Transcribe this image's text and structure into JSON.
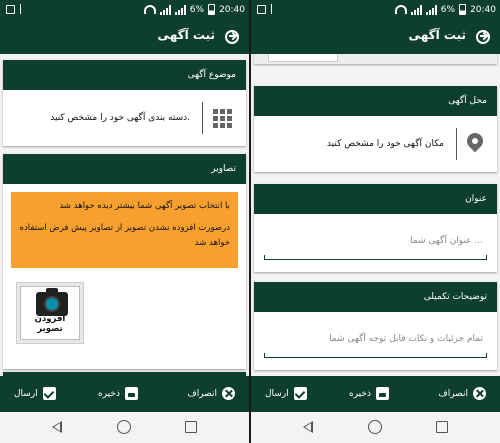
{
  "status": {
    "battery": "6%",
    "time": "20:40"
  },
  "appbar": {
    "title": "ثبت آگهی"
  },
  "left": {
    "category": {
      "header": "موضوع آگهی",
      "prompt": "دسته بندی آگهی خود را مشخص کنید."
    },
    "images": {
      "header": "تصاویر",
      "notice_line1": "با انتخاب تصویر آگهی شما بیشتر دیده خواهد شد",
      "notice_line2": "درصورت افزوده نشدن تصویر از تصاویر پیش فرض استفاده خواهد شد",
      "add_label": "افزودن تصویر"
    }
  },
  "right": {
    "location": {
      "header": "محل آگهی",
      "prompt": "مکان آگهی خود را مشخص کنید"
    },
    "title_field": {
      "header": "عنوان",
      "placeholder": "عنوان آگهی شما ..."
    },
    "description_field": {
      "header": "توضیحات تکمیلی",
      "placeholder": "تمام جزئیات و نکات قابل توجه آگهی شما"
    }
  },
  "actions": {
    "cancel": "انصراف",
    "save": "ذخیره",
    "send": "ارسال"
  },
  "colors": {
    "primary": "#0e3f2e",
    "notice": "#f7a030"
  }
}
